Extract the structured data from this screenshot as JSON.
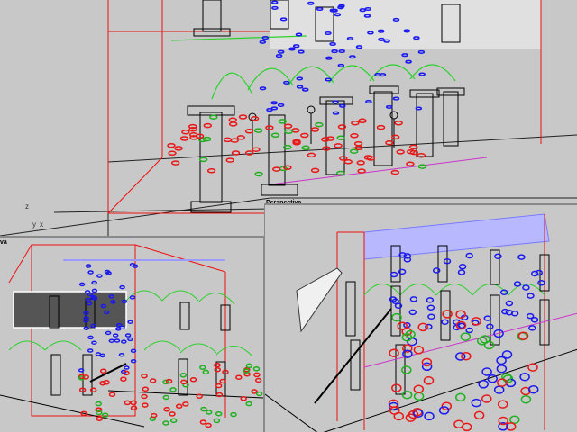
{
  "viewports": {
    "top": {
      "label": ""
    },
    "bottom_left": {
      "label": "va"
    },
    "bottom_right": {
      "label": "Perspectiva"
    }
  },
  "axes": {
    "z": "z",
    "y": "y",
    "x": "x"
  },
  "colors": {
    "background": "#c8c8c8",
    "grid": "#000000",
    "column": "#000000",
    "arch": "#33cc33",
    "bbox": "#ff0000",
    "magenta": "#cc33cc",
    "light_red": "#e81818",
    "light_blue": "#1a1aee",
    "light_green": "#20b020",
    "roof": "#9a9aff"
  }
}
